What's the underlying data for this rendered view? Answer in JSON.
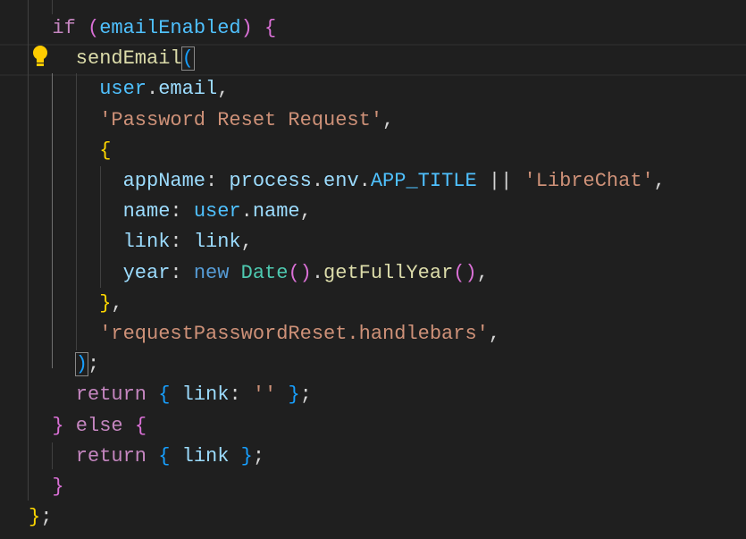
{
  "editor": {
    "lines": [
      {
        "indent": 2,
        "tokens": [
          [
            "if",
            "kw"
          ],
          [
            " ",
            "op"
          ],
          [
            "(",
            "b2"
          ],
          [
            "emailEnabled",
            "const"
          ],
          [
            ")",
            "b2"
          ],
          [
            " ",
            "op"
          ],
          [
            "{",
            "b2"
          ]
        ]
      },
      {
        "indent": 4,
        "tokens": [
          [
            "sendEmail",
            "fn"
          ],
          [
            "(",
            "b3 bm"
          ]
        ]
      },
      {
        "indent": 6,
        "tokens": [
          [
            "user",
            "const"
          ],
          [
            ".",
            "op"
          ],
          [
            "email",
            "var"
          ],
          [
            ",",
            "op"
          ]
        ]
      },
      {
        "indent": 6,
        "tokens": [
          [
            "'Password Reset Request'",
            "str"
          ],
          [
            ",",
            "op"
          ]
        ]
      },
      {
        "indent": 6,
        "tokens": [
          [
            "{",
            "b1"
          ]
        ]
      },
      {
        "indent": 8,
        "tokens": [
          [
            "appName",
            "var"
          ],
          [
            ": ",
            "op"
          ],
          [
            "process",
            "var"
          ],
          [
            ".",
            "op"
          ],
          [
            "env",
            "var"
          ],
          [
            ".",
            "op"
          ],
          [
            "APP_TITLE",
            "const"
          ],
          [
            " || ",
            "op"
          ],
          [
            "'LibreChat'",
            "str"
          ],
          [
            ",",
            "op"
          ]
        ]
      },
      {
        "indent": 8,
        "tokens": [
          [
            "name",
            "var"
          ],
          [
            ": ",
            "op"
          ],
          [
            "user",
            "const"
          ],
          [
            ".",
            "op"
          ],
          [
            "name",
            "var"
          ],
          [
            ",",
            "op"
          ]
        ]
      },
      {
        "indent": 8,
        "tokens": [
          [
            "link",
            "var"
          ],
          [
            ": ",
            "op"
          ],
          [
            "link",
            "var"
          ],
          [
            ",",
            "op"
          ]
        ]
      },
      {
        "indent": 8,
        "tokens": [
          [
            "year",
            "var"
          ],
          [
            ": ",
            "op"
          ],
          [
            "new",
            "nw"
          ],
          [
            " ",
            "op"
          ],
          [
            "Date",
            "cls"
          ],
          [
            "()",
            "b2"
          ],
          [
            ".",
            "op"
          ],
          [
            "getFullYear",
            "fn"
          ],
          [
            "()",
            "b2"
          ],
          [
            ",",
            "op"
          ]
        ]
      },
      {
        "indent": 6,
        "tokens": [
          [
            "}",
            "b1"
          ],
          [
            ",",
            "op"
          ]
        ]
      },
      {
        "indent": 6,
        "tokens": [
          [
            "'requestPasswordReset.handlebars'",
            "str"
          ],
          [
            ",",
            "op"
          ]
        ]
      },
      {
        "indent": 4,
        "tokens": [
          [
            ")",
            "b3 bm"
          ],
          [
            ";",
            "op"
          ]
        ]
      },
      {
        "indent": 4,
        "tokens": [
          [
            "return",
            "kw"
          ],
          [
            " ",
            "op"
          ],
          [
            "{",
            "b3"
          ],
          [
            " ",
            "op"
          ],
          [
            "link",
            "var"
          ],
          [
            ": ",
            "op"
          ],
          [
            "''",
            "str"
          ],
          [
            " ",
            "op"
          ],
          [
            "}",
            "b3"
          ],
          [
            ";",
            "op"
          ]
        ]
      },
      {
        "indent": 2,
        "tokens": [
          [
            "}",
            "b2"
          ],
          [
            " ",
            "op"
          ],
          [
            "else",
            "kw"
          ],
          [
            " ",
            "op"
          ],
          [
            "{",
            "b2"
          ]
        ]
      },
      {
        "indent": 4,
        "tokens": [
          [
            "return",
            "kw"
          ],
          [
            " ",
            "op"
          ],
          [
            "{",
            "b3"
          ],
          [
            " ",
            "op"
          ],
          [
            "link",
            "var"
          ],
          [
            " ",
            "op"
          ],
          [
            "}",
            "b3"
          ],
          [
            ";",
            "op"
          ]
        ]
      },
      {
        "indent": 2,
        "tokens": [
          [
            "}",
            "b2"
          ]
        ]
      },
      {
        "indent": 0,
        "tokens": [
          [
            "}",
            "b1"
          ],
          [
            ";",
            "op"
          ]
        ]
      }
    ],
    "current_line": 1,
    "lightbulb_icon": "lightbulb-icon"
  }
}
